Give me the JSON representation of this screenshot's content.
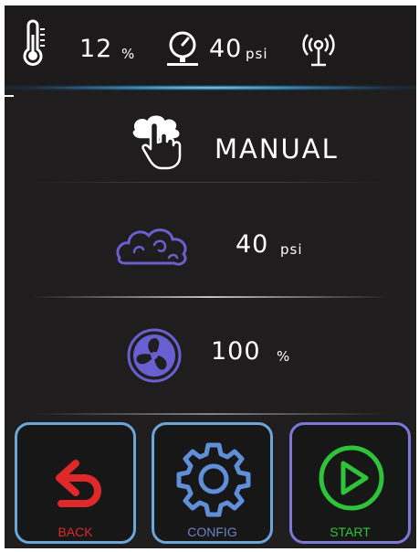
{
  "header": {
    "humidity_value": "12",
    "humidity_unit": "%",
    "pressure_value": "40",
    "pressure_unit": "psi",
    "thermometer_icon": "thermometer-icon",
    "gauge_icon": "pressure-gauge-icon",
    "wireless_icon": "wireless-signal-icon"
  },
  "mode": {
    "label": "MANUAL",
    "icon": "hand-cloud-icon"
  },
  "pressure_setting": {
    "value": "40",
    "unit": "psi",
    "icon": "cloud-icon"
  },
  "fan_setting": {
    "value": "100",
    "unit": "%",
    "icon": "fan-icon"
  },
  "buttons": {
    "back_label": "BACK",
    "config_label": "CONFIG",
    "start_label": "START"
  },
  "colors": {
    "background": "#1f1d1e",
    "accent_purple": "#6a5fd0",
    "button_border": "#6aa6d8",
    "back": "#e0282a",
    "config": "#6f80c8",
    "start": "#2ec43a"
  }
}
